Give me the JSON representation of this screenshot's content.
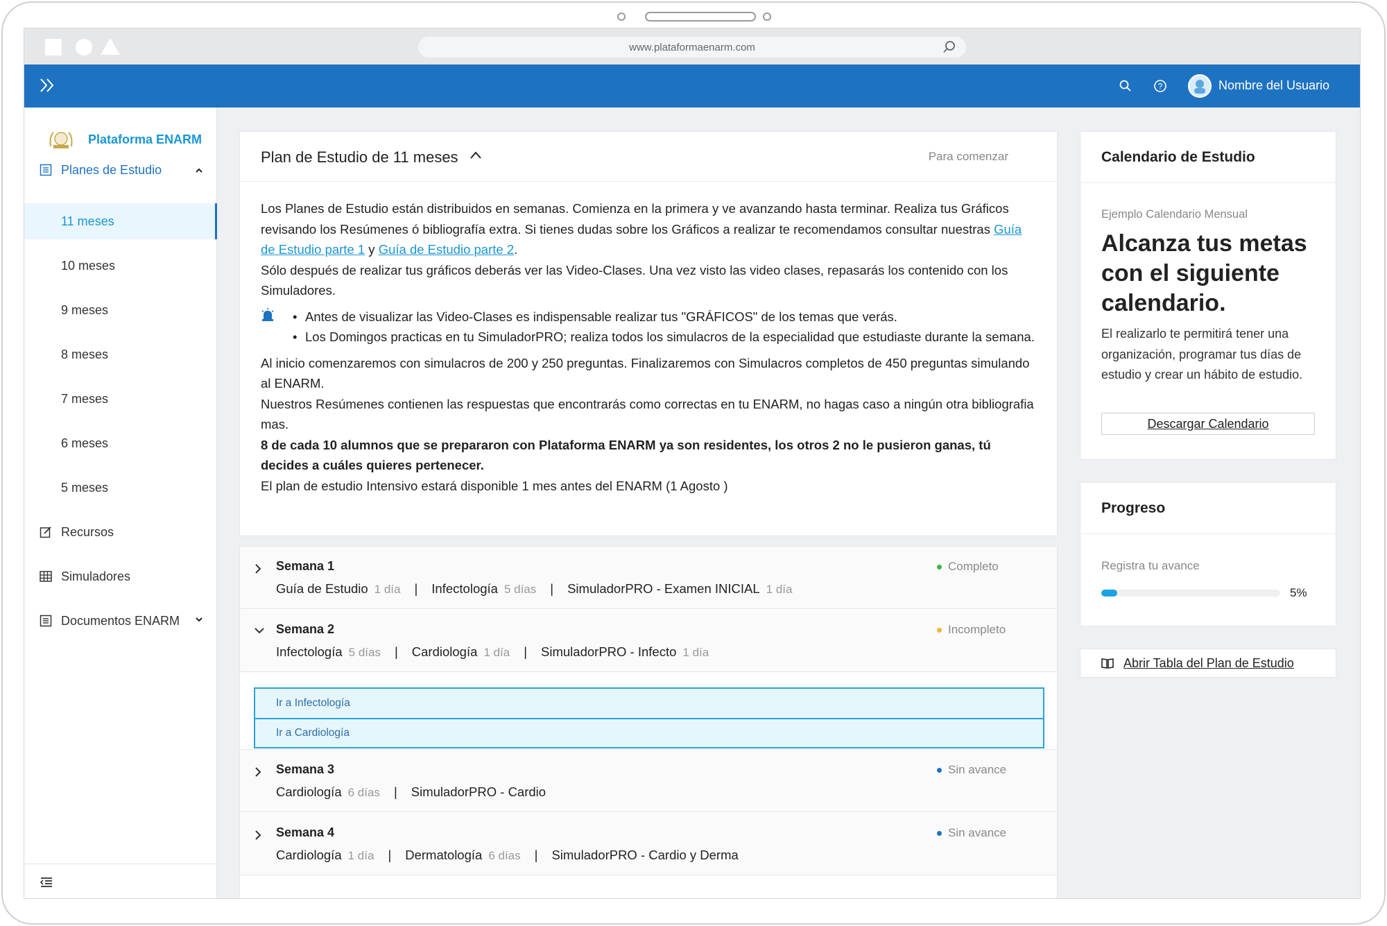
{
  "browser": {
    "url": "www.plataformaenarm.com"
  },
  "topbar": {
    "username": "Nombre del Usuario"
  },
  "sidebar": {
    "brand": "Plataforma ENARM",
    "planes_label": "Planes de Estudio",
    "plans": [
      "11 meses",
      "10 meses",
      "9 meses",
      "8 meses",
      "7 meses",
      "6 meses",
      "5 meses"
    ],
    "recursos": "Recursos",
    "simuladores": "Simuladores",
    "documentos": "Documentos ENARM"
  },
  "plan": {
    "title": "Plan de Estudio de 11 meses",
    "start_label": "Para comenzar",
    "intro_1": "Los Planes de Estudio están distribuidos en semanas. Comienza en la primera y ve avanzando hasta terminar. Realiza tus Gráficos revisando los Resúmenes ó bibliografía extra. Si tienes dudas sobre los Gráficos a realizar te recomendamos consultar nuestras ",
    "link_1": "Guía de Estudio parte 1",
    "and": " y ",
    "link_2": "Guía de Estudio parte 2",
    "period": ".",
    "intro_2": "Sólo después de realizar tus gráficos deberás ver las Video-Clases. Una vez visto las video clases, repasarás los contenido con los Simuladores.",
    "bullet_1": "Antes de visualizar las Video-Clases es indispensable realizar tus \"GRÁFICOS\" de los temas que verás.",
    "bullet_2": "Los Domingos practicas en tu SimuladorPRO; realiza todos los simulacros de la especialidad que estudiaste durante la semana.",
    "para_1": "Al inicio comenzaremos con simulacros de 200 y 250 preguntas. Finalizaremos con Simulacros completos de 450 preguntas simulando al ENARM.",
    "para_2": "Nuestros Resúmenes contienen las respuestas que encontrarás como correctas en tu ENARM, no hagas caso a ningún otra bibliografia mas.",
    "para_bold": "8 de cada 10 alumnos que se prepararon con Plataforma ENARM ya son residentes, los otros 2 no le pusieron ganas, tú decides a cuáles quieres pertenecer.",
    "para_3": "El plan de estudio Intensivo estará disponible 1 mes antes del ENARM  (1 Agosto )"
  },
  "weeks": [
    {
      "title": "Semana 1",
      "status": "Completo",
      "status_color": "#3cb54a",
      "items": [
        {
          "name": "Guía de Estudio",
          "dur": "1 día"
        },
        {
          "name": "Infectología",
          "dur": "5 días"
        },
        {
          "name": "SimuladorPRO - Examen INICIAL",
          "dur": "1 día"
        }
      ]
    },
    {
      "title": "Semana 2",
      "status": "Incompleto",
      "status_color": "#f2b530",
      "items": [
        {
          "name": "Infectología",
          "dur": "5 días"
        },
        {
          "name": "Cardiología",
          "dur": "1 día"
        },
        {
          "name": "SimuladorPRO - Infecto",
          "dur": "1 día"
        }
      ],
      "links": [
        "Ir a Infectología",
        "Ir a Cardiología"
      ]
    },
    {
      "title": "Semana 3",
      "status": "Sin avance",
      "status_color": "#1e72c2",
      "items": [
        {
          "name": "Cardiología",
          "dur": "6 días"
        },
        {
          "name": "SimuladorPRO - Cardio",
          "dur": ""
        }
      ]
    },
    {
      "title": "Semana 4",
      "status": "Sin avance",
      "status_color": "#1e72c2",
      "items": [
        {
          "name": "Cardiología",
          "dur": "1 día"
        },
        {
          "name": "Dermatología",
          "dur": "6 días"
        },
        {
          "name": "SimuladorPRO - Cardio y Derma",
          "dur": ""
        }
      ]
    }
  ],
  "calendar": {
    "title": "Calendario de Estudio",
    "subtitle": "Ejemplo Calendario Mensual",
    "headline": "Alcanza tus metas con el siguiente calendario.",
    "desc": "El realizarlo te permitirá tener una organización, programar tus días de estudio y crear un hábito de estudio.",
    "button": "Descargar Calendario"
  },
  "progress": {
    "title": "Progreso",
    "subtitle": "Registra tu avance",
    "value": 5,
    "value_label": "5%"
  },
  "table_button": "Abrir Tabla del Plan de Estudio",
  "colors": {
    "primary": "#1e72c2",
    "accent": "#1a96d4"
  }
}
